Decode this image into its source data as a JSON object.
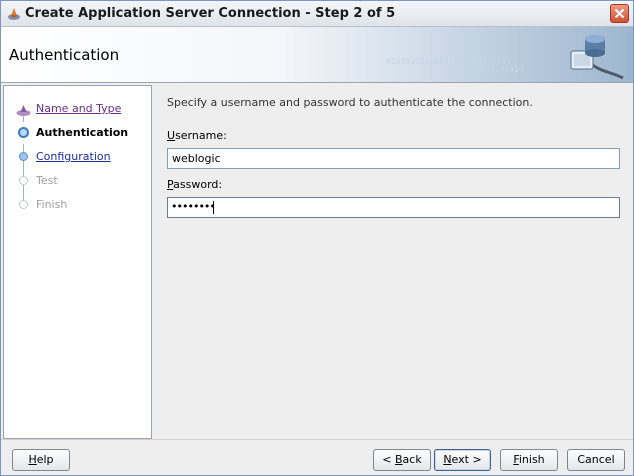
{
  "window": {
    "title": "Create Application Server Connection - Step 2 of 5"
  },
  "header": {
    "title": "Authentication",
    "graphic_icon": "database-connection-icon"
  },
  "steps": [
    {
      "label": "Name and Type",
      "state": "visited"
    },
    {
      "label": "Authentication",
      "state": "current"
    },
    {
      "label": "Configuration",
      "state": "link"
    },
    {
      "label": "Test",
      "state": "disabled"
    },
    {
      "label": "Finish",
      "state": "disabled"
    }
  ],
  "content": {
    "instructions": "Specify a username and password to authenticate the connection.",
    "username": {
      "label_mnemonic": "U",
      "label_rest": "sername:",
      "value": "weblogic"
    },
    "password": {
      "label_mnemonic": "P",
      "label_rest": "assword:",
      "value": "••••••••"
    }
  },
  "buttons": {
    "help": {
      "mnemonic": "H",
      "rest": "elp"
    },
    "back": {
      "prefix": "< ",
      "mnemonic": "B",
      "rest": "ack"
    },
    "next": {
      "mnemonic": "N",
      "rest": "ext >"
    },
    "finish": {
      "mnemonic": "F",
      "rest": "inish"
    },
    "cancel": {
      "label": "Cancel"
    }
  },
  "colors": {
    "link": "#1a2d9c",
    "visited_link": "#6b2c8a",
    "close_button": "#d3502f",
    "header_accent": "#9db6cf"
  }
}
